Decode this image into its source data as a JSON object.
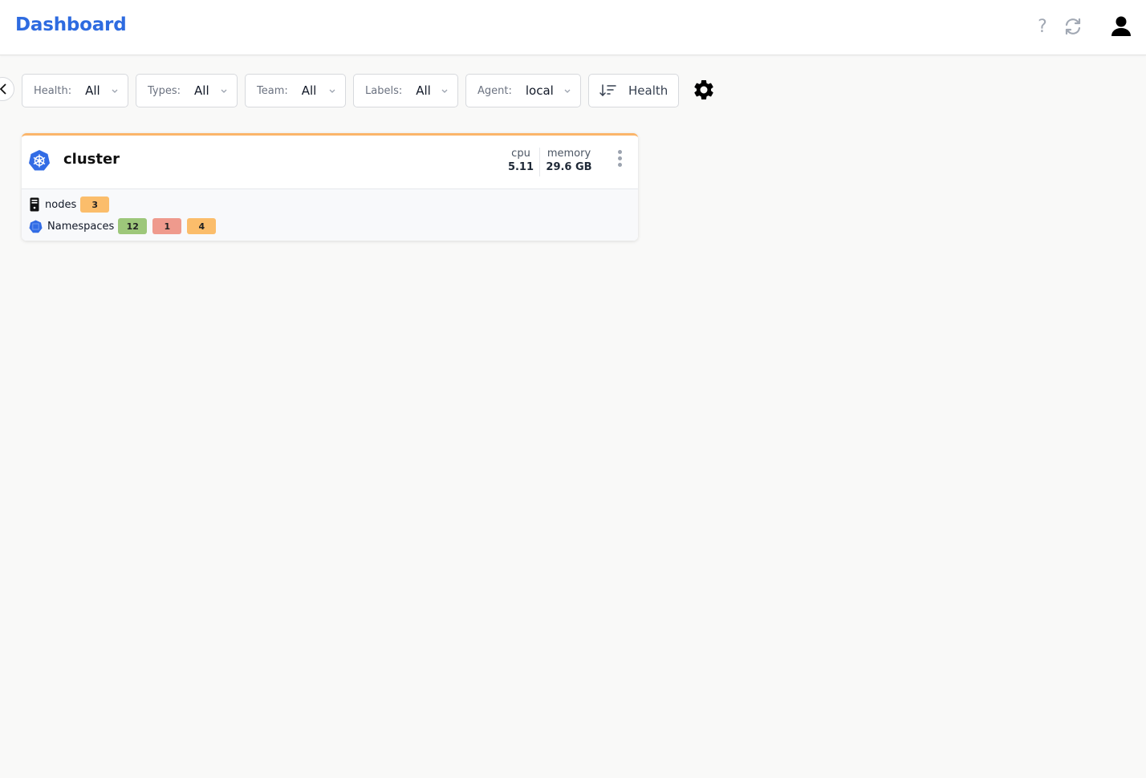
{
  "header": {
    "title": "Dashboard",
    "icons": [
      "help-icon",
      "refresh-icon",
      "user-icon"
    ],
    "help_glyph": "?"
  },
  "filters": [
    {
      "label": "Health:",
      "value": "All"
    },
    {
      "label": "Types:",
      "value": "All"
    },
    {
      "label": "Team:",
      "value": "All"
    },
    {
      "label": "Labels:",
      "value": "All"
    },
    {
      "label": "Agent:",
      "value": "local"
    }
  ],
  "sort": {
    "label": "Health",
    "icon": "sort-descending-icon"
  },
  "settings": {
    "icon": "gear-icon"
  },
  "cards": [
    {
      "name": "cluster",
      "icon": "kubernetes-icon",
      "status_color": "#fbb56a",
      "metrics": [
        {
          "label": "cpu",
          "value": "5.11"
        },
        {
          "label": "memory",
          "value": "29.6 GB"
        }
      ],
      "resources": [
        {
          "label": "nodes",
          "icon": "server-icon",
          "badges": [
            {
              "value": "3",
              "status": "warning",
              "color": "#fbbd6b"
            }
          ]
        },
        {
          "label": "Namespaces",
          "icon": "namespace-icon",
          "badges": [
            {
              "value": "12",
              "status": "healthy",
              "color": "#9dc77a"
            },
            {
              "value": "1",
              "status": "unhealthy",
              "color": "#ef9a8d"
            },
            {
              "value": "4",
              "status": "warning",
              "color": "#fbbd6b"
            }
          ]
        }
      ]
    }
  ],
  "colors": {
    "accent": "#2e6be0",
    "healthy": "#9dc77a",
    "unhealthy": "#ef9a8d",
    "warning": "#fbbd6b"
  }
}
